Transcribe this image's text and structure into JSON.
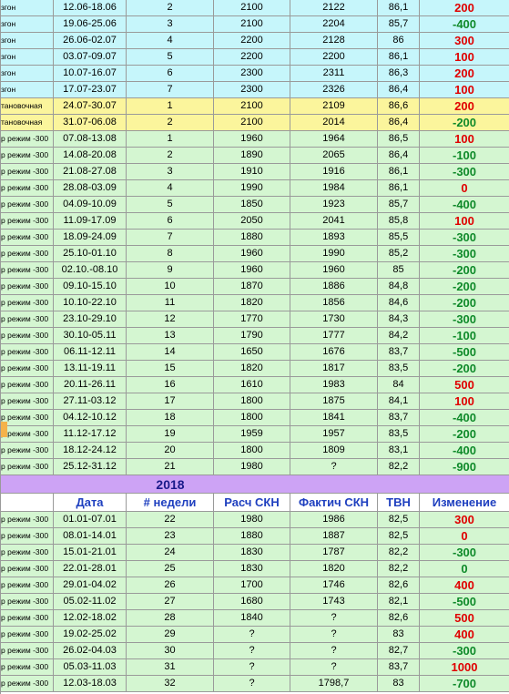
{
  "columns": {
    "blank": "",
    "date": "Дата",
    "week": "# недели",
    "calc": "Расч СКН",
    "fact": "Фактич СКН",
    "tvn": "ТВН",
    "change": "Изменение"
  },
  "year_label": "2018",
  "rows_2017": [
    {
      "mode": "згон",
      "date": "12.06-18.06",
      "week": "2",
      "calc": "2100",
      "fact": "2122",
      "tvn": "86,1",
      "change": "200",
      "sign": "pos",
      "bg": "blue"
    },
    {
      "mode": "згон",
      "date": "19.06-25.06",
      "week": "3",
      "calc": "2100",
      "fact": "2204",
      "tvn": "85,7",
      "change": "-400",
      "sign": "neg",
      "bg": "blue"
    },
    {
      "mode": "згон",
      "date": "26.06-02.07",
      "week": "4",
      "calc": "2200",
      "fact": "2128",
      "tvn": "86",
      "change": "300",
      "sign": "pos",
      "bg": "blue"
    },
    {
      "mode": "згон",
      "date": "03.07-09.07",
      "week": "5",
      "calc": "2200",
      "fact": "2200",
      "tvn": "86,1",
      "change": "100",
      "sign": "pos",
      "bg": "blue"
    },
    {
      "mode": "згон",
      "date": "10.07-16.07",
      "week": "6",
      "calc": "2300",
      "fact": "2311",
      "tvn": "86,3",
      "change": "200",
      "sign": "pos",
      "bg": "blue"
    },
    {
      "mode": "згон",
      "date": "17.07-23.07",
      "week": "7",
      "calc": "2300",
      "fact": "2326",
      "tvn": "86,4",
      "change": "100",
      "sign": "pos",
      "bg": "blue"
    },
    {
      "mode": "тановочная",
      "date": "24.07-30.07",
      "week": "1",
      "calc": "2100",
      "fact": "2109",
      "tvn": "86,6",
      "change": "200",
      "sign": "pos",
      "bg": "yellow"
    },
    {
      "mode": "тановочная",
      "date": "31.07-06.08",
      "week": "2",
      "calc": "2100",
      "fact": "2014",
      "tvn": "86,4",
      "change": "-200",
      "sign": "neg",
      "bg": "yellow"
    },
    {
      "mode": "р режим -300",
      "date": "07.08-13.08",
      "week": "1",
      "calc": "1960",
      "fact": "1964",
      "tvn": "86,5",
      "change": "100",
      "sign": "pos",
      "bg": "green"
    },
    {
      "mode": "р режим -300",
      "date": "14.08-20.08",
      "week": "2",
      "calc": "1890",
      "fact": "2065",
      "tvn": "86,4",
      "change": "-100",
      "sign": "neg",
      "bg": "green"
    },
    {
      "mode": "р режим -300",
      "date": "21.08-27.08",
      "week": "3",
      "calc": "1910",
      "fact": "1916",
      "tvn": "86,1",
      "change": "-300",
      "sign": "neg",
      "bg": "green"
    },
    {
      "mode": "р режим -300",
      "date": "28.08-03.09",
      "week": "4",
      "calc": "1990",
      "fact": "1984",
      "tvn": "86,1",
      "change": "0",
      "sign": "pos",
      "bg": "green"
    },
    {
      "mode": "р режим -300",
      "date": "04.09-10.09",
      "week": "5",
      "calc": "1850",
      "fact": "1923",
      "tvn": "85,7",
      "change": "-400",
      "sign": "neg",
      "bg": "green"
    },
    {
      "mode": "р режим -300",
      "date": "11.09-17.09",
      "week": "6",
      "calc": "2050",
      "fact": "2041",
      "tvn": "85,8",
      "change": "100",
      "sign": "pos",
      "bg": "green"
    },
    {
      "mode": "р режим -300",
      "date": "18.09-24.09",
      "week": "7",
      "calc": "1880",
      "fact": "1893",
      "tvn": "85,5",
      "change": "-300",
      "sign": "neg",
      "bg": "green"
    },
    {
      "mode": "р режим -300",
      "date": "25.10-01.10",
      "week": "8",
      "calc": "1960",
      "fact": "1990",
      "tvn": "85,2",
      "change": "-300",
      "sign": "neg",
      "bg": "green"
    },
    {
      "mode": "р режим -300",
      "date": "02.10.-08.10",
      "week": "9",
      "calc": "1960",
      "fact": "1960",
      "tvn": "85",
      "change": "-200",
      "sign": "neg",
      "bg": "green"
    },
    {
      "mode": "р режим -300",
      "date": "09.10-15.10",
      "week": "10",
      "calc": "1870",
      "fact": "1886",
      "tvn": "84,8",
      "change": "-200",
      "sign": "neg",
      "bg": "green"
    },
    {
      "mode": "р режим -300",
      "date": "10.10-22.10",
      "week": "11",
      "calc": "1820",
      "fact": "1856",
      "tvn": "84,6",
      "change": "-200",
      "sign": "neg",
      "bg": "green"
    },
    {
      "mode": "р режим -300",
      "date": "23.10-29.10",
      "week": "12",
      "calc": "1770",
      "fact": "1730",
      "tvn": "84,3",
      "change": "-300",
      "sign": "neg",
      "bg": "green"
    },
    {
      "mode": "р режим -300",
      "date": "30.10-05.11",
      "week": "13",
      "calc": "1790",
      "fact": "1777",
      "tvn": "84,2",
      "change": "-100",
      "sign": "neg",
      "bg": "green"
    },
    {
      "mode": "р режим -300",
      "date": "06.11-12.11",
      "week": "14",
      "calc": "1650",
      "fact": "1676",
      "tvn": "83,7",
      "change": "-500",
      "sign": "neg",
      "bg": "green"
    },
    {
      "mode": "р режим -300",
      "date": "13.11-19.11",
      "week": "15",
      "calc": "1820",
      "fact": "1817",
      "tvn": "83,5",
      "change": "-200",
      "sign": "neg",
      "bg": "green"
    },
    {
      "mode": "р режим -300",
      "date": "20.11-26.11",
      "week": "16",
      "calc": "1610",
      "fact": "1983",
      "tvn": "84",
      "change": "500",
      "sign": "pos",
      "bg": "green"
    },
    {
      "mode": "р режим -300",
      "date": "27.11-03.12",
      "week": "17",
      "calc": "1800",
      "fact": "1875",
      "tvn": "84,1",
      "change": "100",
      "sign": "pos",
      "bg": "green"
    },
    {
      "mode": "р режим -300",
      "date": "04.12-10.12",
      "week": "18",
      "calc": "1800",
      "fact": "1841",
      "tvn": "83,7",
      "change": "-400",
      "sign": "neg",
      "bg": "green"
    },
    {
      "mode": "р режим -300",
      "date": "11.12-17.12",
      "week": "19",
      "calc": "1959",
      "fact": "1957",
      "tvn": "83,5",
      "change": "-200",
      "sign": "neg",
      "bg": "green"
    },
    {
      "mode": "р режим -300",
      "date": "18.12-24.12",
      "week": "20",
      "calc": "1800",
      "fact": "1809",
      "tvn": "83,1",
      "change": "-400",
      "sign": "neg",
      "bg": "green"
    },
    {
      "mode": "р режим -300",
      "date": "25.12-31.12",
      "week": "21",
      "calc": "1980",
      "fact": "?",
      "tvn": "82,2",
      "change": "-900",
      "sign": "neg",
      "bg": "green"
    }
  ],
  "rows_2018": [
    {
      "mode": "р режим -300",
      "date": "01.01-07.01",
      "week": "22",
      "calc": "1980",
      "fact": "1986",
      "tvn": "82,5",
      "change": "300",
      "sign": "pos",
      "bg": "green"
    },
    {
      "mode": "р режим -300",
      "date": "08.01-14.01",
      "week": "23",
      "calc": "1880",
      "fact": "1887",
      "tvn": "82,5",
      "change": "0",
      "sign": "pos",
      "bg": "green"
    },
    {
      "mode": "р режим -300",
      "date": "15.01-21.01",
      "week": "24",
      "calc": "1830",
      "fact": "1787",
      "tvn": "82,2",
      "change": "-300",
      "sign": "neg",
      "bg": "green"
    },
    {
      "mode": "р режим -300",
      "date": "22.01-28.01",
      "week": "25",
      "calc": "1830",
      "fact": "1820",
      "tvn": "82,2",
      "change": "0",
      "sign": "neg",
      "bg": "green"
    },
    {
      "mode": "р режим -300",
      "date": "29.01-04.02",
      "week": "26",
      "calc": "1700",
      "fact": "1746",
      "tvn": "82,6",
      "change": "400",
      "sign": "pos",
      "bg": "green"
    },
    {
      "mode": "р режим -300",
      "date": "05.02-11.02",
      "week": "27",
      "calc": "1680",
      "fact": "1743",
      "tvn": "82,1",
      "change": "-500",
      "sign": "neg",
      "bg": "green"
    },
    {
      "mode": "р режим -300",
      "date": "12.02-18.02",
      "week": "28",
      "calc": "1840",
      "fact": "?",
      "tvn": "82,6",
      "change": "500",
      "sign": "pos",
      "bg": "green"
    },
    {
      "mode": "р режим -300",
      "date": "19.02-25.02",
      "week": "29",
      "calc": "?",
      "fact": "?",
      "tvn": "83",
      "change": "400",
      "sign": "pos",
      "bg": "green"
    },
    {
      "mode": "р режим -300",
      "date": "26.02-04.03",
      "week": "30",
      "calc": "?",
      "fact": "?",
      "tvn": "82,7",
      "change": "-300",
      "sign": "neg",
      "bg": "green"
    },
    {
      "mode": "р режим -300",
      "date": "05.03-11.03",
      "week": "31",
      "calc": "?",
      "fact": "?",
      "tvn": "83,7",
      "change": "1000",
      "sign": "pos",
      "bg": "green"
    },
    {
      "mode": "р режим -300",
      "date": "12.03-18.03",
      "week": "32",
      "calc": "?",
      "fact": "1798,7",
      "tvn": "83",
      "change": "-700",
      "sign": "neg",
      "bg": "green"
    }
  ]
}
